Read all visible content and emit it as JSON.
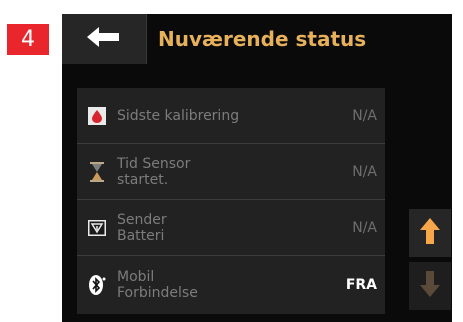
{
  "step_number": "4",
  "header": {
    "title": "Nuværende status"
  },
  "status_rows": [
    {
      "label": "Sidste kalibrering",
      "value": "N/A",
      "icon": "blood-drop-icon"
    },
    {
      "label": "Tid Sensor\nstartet.",
      "value": "N/A",
      "icon": "hourglass-icon"
    },
    {
      "label": "Sender\nBatteri",
      "value": "N/A",
      "icon": "transmitter-icon"
    },
    {
      "label": "Mobil\nForbindelse",
      "value": "FRA",
      "icon": "bluetooth-icon"
    }
  ],
  "colors": {
    "accent": "#e6b15a",
    "step_badge": "#e8262b",
    "arrow_active": "#f5a74a",
    "arrow_disabled": "#5a4a3a"
  }
}
